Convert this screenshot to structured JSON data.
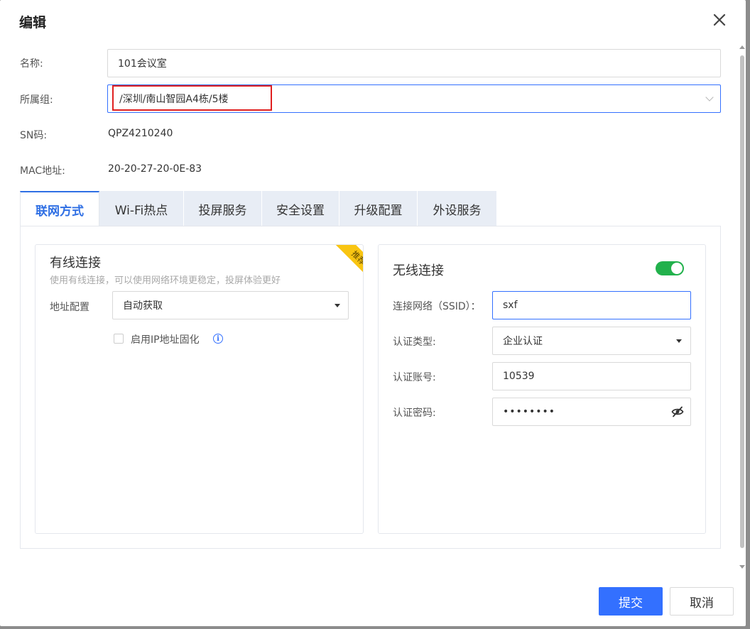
{
  "dialog": {
    "title": "编辑"
  },
  "form": {
    "name_label": "名称:",
    "name_value": "101会议室",
    "group_label": "所属组:",
    "group_value": "/深圳/南山智园A4栋/5楼",
    "sn_label": "SN码:",
    "sn_value": "QPZ4210240",
    "mac_label": "MAC地址:",
    "mac_value": "20-20-27-20-0E-83"
  },
  "tabs": [
    {
      "label": "联网方式",
      "active": true
    },
    {
      "label": "Wi-Fi热点",
      "active": false
    },
    {
      "label": "投屏服务",
      "active": false
    },
    {
      "label": "安全设置",
      "active": false
    },
    {
      "label": "升级配置",
      "active": false
    },
    {
      "label": "外设服务",
      "active": false
    }
  ],
  "wired": {
    "title": "有线连接",
    "subtitle": "使用有线连接，可以使用网络环境更稳定，投屏体验更好",
    "badge": "推荐",
    "address_label": "地址配置",
    "address_value": "自动获取",
    "fixed_ip_label": "启用IP地址固化",
    "fixed_ip_checked": false
  },
  "wireless": {
    "title": "无线连接",
    "enabled": true,
    "ssid_label": "连接网络（SSID）：",
    "ssid_value": "sxf",
    "auth_type_label": "认证类型:",
    "auth_type_value": "企业认证",
    "account_label": "认证账号:",
    "account_value": "10539",
    "password_label": "认证密码:",
    "password_value": "••••••••"
  },
  "footer": {
    "submit_label": "提交",
    "cancel_label": "取消"
  },
  "colors": {
    "primary": "#3370ff",
    "tab_active": "#2f6fe4",
    "toggle_on": "#22b14c",
    "badge": "#f9c512",
    "highlight_border": "#e02020"
  }
}
